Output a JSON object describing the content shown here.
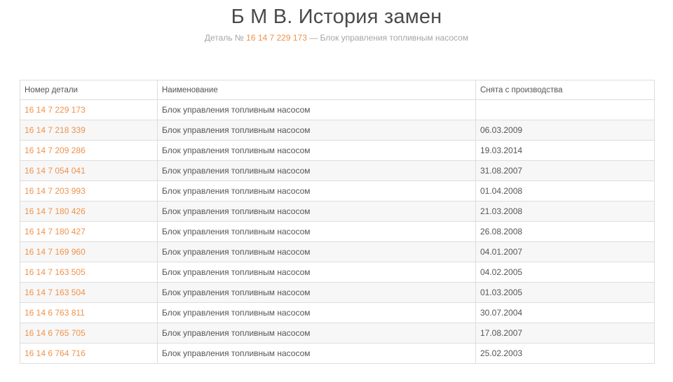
{
  "page": {
    "title": "Б М В. История замен",
    "subtitle_prefix": "Деталь № ",
    "subtitle_part_number": "16 14 7 229 173",
    "subtitle_suffix": " — Блок управления топливным насосом"
  },
  "colors": {
    "accent": "#f0924a",
    "text": "#555555",
    "muted": "#a6a6a6",
    "border": "#dddddd",
    "stripe": "#f7f7f7"
  },
  "table": {
    "headers": [
      "Номер детали",
      "Наименование",
      "Снята с производства"
    ],
    "rows": [
      {
        "number": "16 14 7 229 173",
        "name": "Блок управления топливным насосом",
        "discontinued": ""
      },
      {
        "number": "16 14 7 218 339",
        "name": "Блок управления топливным насосом",
        "discontinued": "06.03.2009"
      },
      {
        "number": "16 14 7 209 286",
        "name": "Блок управления топливным насосом",
        "discontinued": "19.03.2014"
      },
      {
        "number": "16 14 7 054 041",
        "name": "Блок управления топливным насосом",
        "discontinued": "31.08.2007"
      },
      {
        "number": "16 14 7 203 993",
        "name": "Блок управления топливным насосом",
        "discontinued": "01.04.2008"
      },
      {
        "number": "16 14 7 180 426",
        "name": "Блок управления топливным насосом",
        "discontinued": "21.03.2008"
      },
      {
        "number": "16 14 7 180 427",
        "name": "Блок управления топливным насосом",
        "discontinued": "26.08.2008"
      },
      {
        "number": "16 14 7 169 960",
        "name": "Блок управления топливным насосом",
        "discontinued": "04.01.2007"
      },
      {
        "number": "16 14 7 163 505",
        "name": "Блок управления топливным насосом",
        "discontinued": "04.02.2005"
      },
      {
        "number": "16 14 7 163 504",
        "name": "Блок управления топливным насосом",
        "discontinued": "01.03.2005"
      },
      {
        "number": "16 14 6 763 811",
        "name": "Блок управления топливным насосом",
        "discontinued": "30.07.2004"
      },
      {
        "number": "16 14 6 765 705",
        "name": "Блок управления топливным насосом",
        "discontinued": "17.08.2007"
      },
      {
        "number": "16 14 6 764 716",
        "name": "Блок управления топливным насосом",
        "discontinued": "25.02.2003"
      }
    ]
  }
}
